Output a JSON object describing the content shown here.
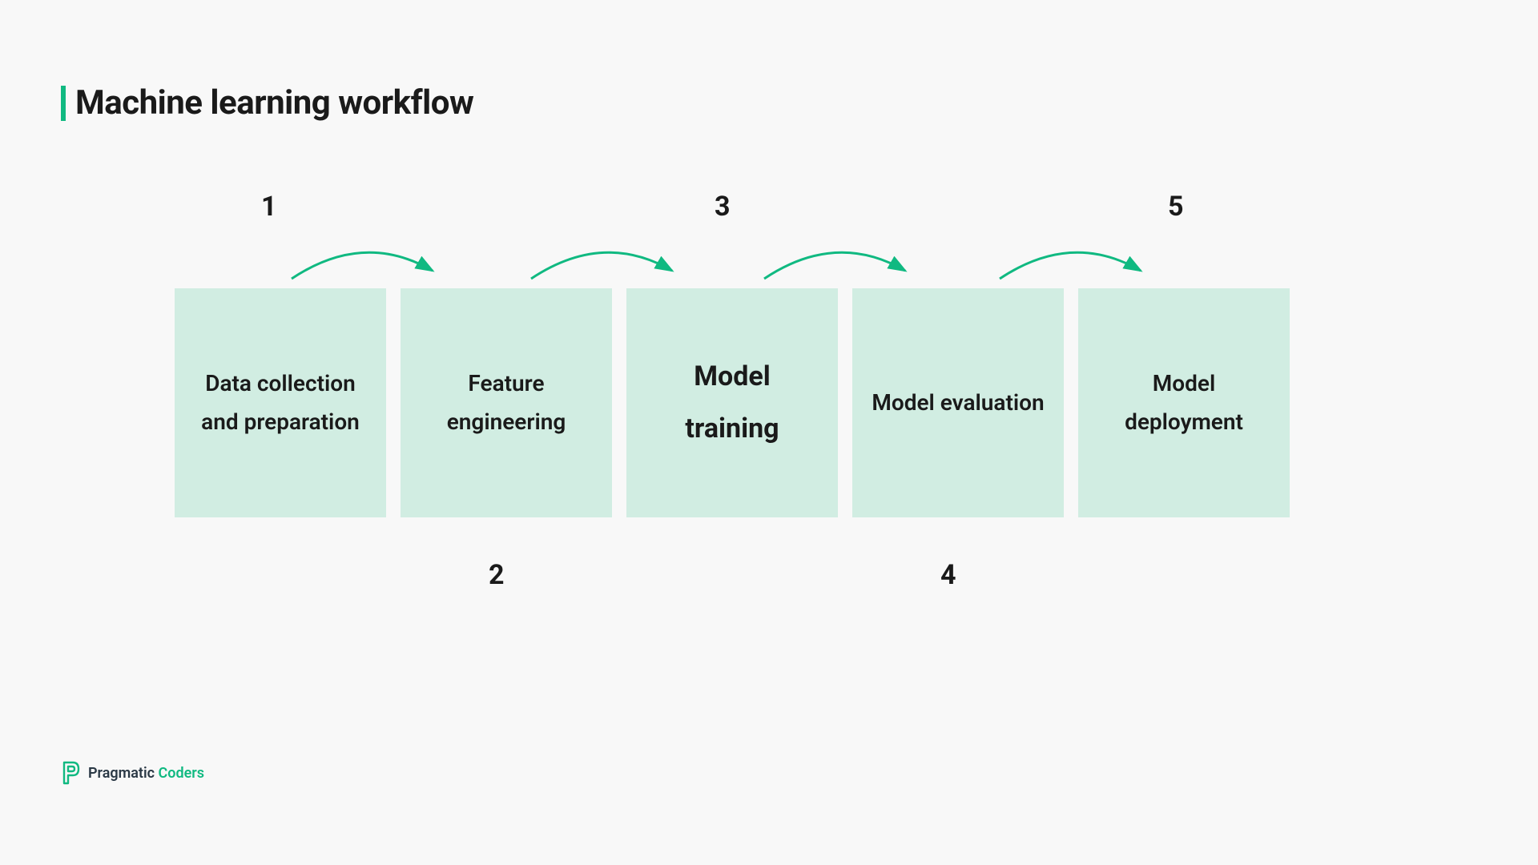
{
  "title": "Machine learning workflow",
  "colors": {
    "accent": "#10b981",
    "box_bg": "#d1ede2",
    "page_bg": "#f8f8f8",
    "text": "#1a1a1a"
  },
  "steps": [
    {
      "number": "1",
      "label": "Data collection and preparation",
      "emphasis": false,
      "number_position": "top"
    },
    {
      "number": "2",
      "label": "Feature engineering",
      "emphasis": false,
      "number_position": "bottom"
    },
    {
      "number": "3",
      "label": "Model training",
      "emphasis": true,
      "number_position": "top"
    },
    {
      "number": "4",
      "label": "Model evaluation",
      "emphasis": false,
      "number_position": "bottom"
    },
    {
      "number": "5",
      "label": "Model deployment",
      "emphasis": false,
      "number_position": "top"
    }
  ],
  "logo": {
    "word1": "Pragmatic",
    "word2": "Coders"
  }
}
